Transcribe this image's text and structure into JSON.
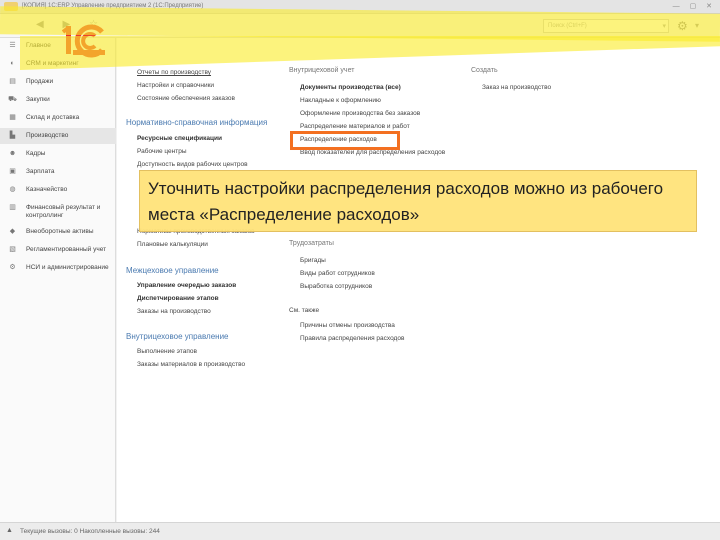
{
  "window": {
    "title": "[КОПИЯ] 1С:ERP Управление предприятием 2 (1С:Предприятие)"
  },
  "toolbar": {
    "search_placeholder": "Поиск (Ctrl+F)"
  },
  "sidebar": {
    "items": [
      {
        "label": "Главное",
        "icon": "menu-icon"
      },
      {
        "label": "CRM и маркетинг",
        "icon": "crm-icon"
      },
      {
        "label": "Продажи",
        "icon": "sales-icon"
      },
      {
        "label": "Закупки",
        "icon": "cart-icon"
      },
      {
        "label": "Склад и доставка",
        "icon": "warehouse-icon"
      },
      {
        "label": "Производство",
        "icon": "factory-icon"
      },
      {
        "label": "Кадры",
        "icon": "people-icon"
      },
      {
        "label": "Зарплата",
        "icon": "salary-icon"
      },
      {
        "label": "Казначейство",
        "icon": "treasury-icon"
      },
      {
        "label": "Финансовый результат и контроллинг",
        "icon": "chart-icon"
      },
      {
        "label": "Внеоборотные активы",
        "icon": "assets-icon"
      },
      {
        "label": "Регламентированный учет",
        "icon": "ledger-icon"
      },
      {
        "label": "НСИ и администрирование",
        "icon": "gear-icon"
      }
    ],
    "active_index": 5
  },
  "main": {
    "col1": {
      "top_links": [
        "Отчеты по производству",
        "Настройки и справочники",
        "Состояние обеспечения заказов"
      ],
      "nsi_header": "Нормативно-справочная информация",
      "nsi_items": [
        "Ресурсные спецификации",
        "Рабочие центры",
        "Доступность видов рабочих центров"
      ],
      "nsi_items_lower": [
        "Нормативы производственных заказов",
        "Плановые калькуляции"
      ],
      "mezh_header": "Межцеховое управление",
      "mezh_items": [
        "Управление очередью заказов",
        "Диспетчирование этапов",
        "Заказы на производство"
      ],
      "vnutr_header": "Внутрицеховое управление",
      "vnutr_items": [
        "Выполнение этапов",
        "Заказы материалов в производство"
      ]
    },
    "col2": {
      "vu_header": "Внутрицеховой учет",
      "vu_items": [
        "Документы производства (все)",
        "Накладные к оформлению",
        "Оформление производства без заказов",
        "Распределение материалов и работ",
        "Распределение расходов",
        "Ввод показателей для распределения расходов"
      ],
      "trud_header": "Трудозатраты",
      "trud_items": [
        "Бригады",
        "Виды работ сотрудников",
        "Выработка сотрудников"
      ],
      "see_also_header": "См. также",
      "see_also_items": [
        "Причины отмены производства",
        "Правила распределения расходов"
      ]
    },
    "col3": {
      "create_header": "Создать",
      "create_items": [
        "Заказ на производство"
      ]
    }
  },
  "callout": {
    "text": "Уточнить настройки распределения расходов можно из рабочего места «Распределение расходов»"
  },
  "statusbar": {
    "text": "Текущие вызовы: 0   Накопленные вызовы: 244"
  },
  "colors": {
    "highlight": "#f37021",
    "marker": "#fae92d",
    "callout_bg": "#ffe278",
    "link_header": "#4a7ab0"
  }
}
